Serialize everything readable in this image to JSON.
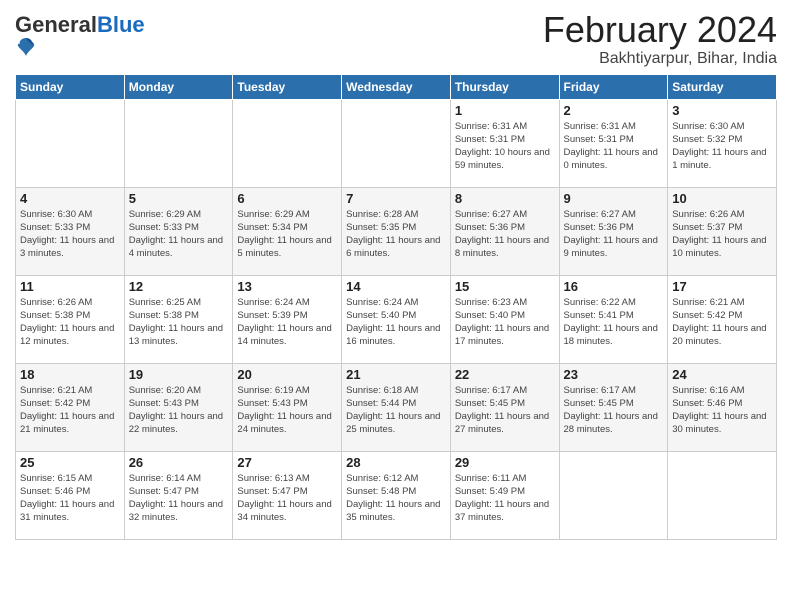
{
  "logo": {
    "general": "General",
    "blue": "Blue"
  },
  "title": "February 2024",
  "subtitle": "Bakhtiyarpur, Bihar, India",
  "weekdays": [
    "Sunday",
    "Monday",
    "Tuesday",
    "Wednesday",
    "Thursday",
    "Friday",
    "Saturday"
  ],
  "weeks": [
    [
      {
        "day": "",
        "info": ""
      },
      {
        "day": "",
        "info": ""
      },
      {
        "day": "",
        "info": ""
      },
      {
        "day": "",
        "info": ""
      },
      {
        "day": "1",
        "info": "Sunrise: 6:31 AM\nSunset: 5:31 PM\nDaylight: 10 hours and 59 minutes."
      },
      {
        "day": "2",
        "info": "Sunrise: 6:31 AM\nSunset: 5:31 PM\nDaylight: 11 hours and 0 minutes."
      },
      {
        "day": "3",
        "info": "Sunrise: 6:30 AM\nSunset: 5:32 PM\nDaylight: 11 hours and 1 minute."
      }
    ],
    [
      {
        "day": "4",
        "info": "Sunrise: 6:30 AM\nSunset: 5:33 PM\nDaylight: 11 hours and 3 minutes."
      },
      {
        "day": "5",
        "info": "Sunrise: 6:29 AM\nSunset: 5:33 PM\nDaylight: 11 hours and 4 minutes."
      },
      {
        "day": "6",
        "info": "Sunrise: 6:29 AM\nSunset: 5:34 PM\nDaylight: 11 hours and 5 minutes."
      },
      {
        "day": "7",
        "info": "Sunrise: 6:28 AM\nSunset: 5:35 PM\nDaylight: 11 hours and 6 minutes."
      },
      {
        "day": "8",
        "info": "Sunrise: 6:27 AM\nSunset: 5:36 PM\nDaylight: 11 hours and 8 minutes."
      },
      {
        "day": "9",
        "info": "Sunrise: 6:27 AM\nSunset: 5:36 PM\nDaylight: 11 hours and 9 minutes."
      },
      {
        "day": "10",
        "info": "Sunrise: 6:26 AM\nSunset: 5:37 PM\nDaylight: 11 hours and 10 minutes."
      }
    ],
    [
      {
        "day": "11",
        "info": "Sunrise: 6:26 AM\nSunset: 5:38 PM\nDaylight: 11 hours and 12 minutes."
      },
      {
        "day": "12",
        "info": "Sunrise: 6:25 AM\nSunset: 5:38 PM\nDaylight: 11 hours and 13 minutes."
      },
      {
        "day": "13",
        "info": "Sunrise: 6:24 AM\nSunset: 5:39 PM\nDaylight: 11 hours and 14 minutes."
      },
      {
        "day": "14",
        "info": "Sunrise: 6:24 AM\nSunset: 5:40 PM\nDaylight: 11 hours and 16 minutes."
      },
      {
        "day": "15",
        "info": "Sunrise: 6:23 AM\nSunset: 5:40 PM\nDaylight: 11 hours and 17 minutes."
      },
      {
        "day": "16",
        "info": "Sunrise: 6:22 AM\nSunset: 5:41 PM\nDaylight: 11 hours and 18 minutes."
      },
      {
        "day": "17",
        "info": "Sunrise: 6:21 AM\nSunset: 5:42 PM\nDaylight: 11 hours and 20 minutes."
      }
    ],
    [
      {
        "day": "18",
        "info": "Sunrise: 6:21 AM\nSunset: 5:42 PM\nDaylight: 11 hours and 21 minutes."
      },
      {
        "day": "19",
        "info": "Sunrise: 6:20 AM\nSunset: 5:43 PM\nDaylight: 11 hours and 22 minutes."
      },
      {
        "day": "20",
        "info": "Sunrise: 6:19 AM\nSunset: 5:43 PM\nDaylight: 11 hours and 24 minutes."
      },
      {
        "day": "21",
        "info": "Sunrise: 6:18 AM\nSunset: 5:44 PM\nDaylight: 11 hours and 25 minutes."
      },
      {
        "day": "22",
        "info": "Sunrise: 6:17 AM\nSunset: 5:45 PM\nDaylight: 11 hours and 27 minutes."
      },
      {
        "day": "23",
        "info": "Sunrise: 6:17 AM\nSunset: 5:45 PM\nDaylight: 11 hours and 28 minutes."
      },
      {
        "day": "24",
        "info": "Sunrise: 6:16 AM\nSunset: 5:46 PM\nDaylight: 11 hours and 30 minutes."
      }
    ],
    [
      {
        "day": "25",
        "info": "Sunrise: 6:15 AM\nSunset: 5:46 PM\nDaylight: 11 hours and 31 minutes."
      },
      {
        "day": "26",
        "info": "Sunrise: 6:14 AM\nSunset: 5:47 PM\nDaylight: 11 hours and 32 minutes."
      },
      {
        "day": "27",
        "info": "Sunrise: 6:13 AM\nSunset: 5:47 PM\nDaylight: 11 hours and 34 minutes."
      },
      {
        "day": "28",
        "info": "Sunrise: 6:12 AM\nSunset: 5:48 PM\nDaylight: 11 hours and 35 minutes."
      },
      {
        "day": "29",
        "info": "Sunrise: 6:11 AM\nSunset: 5:49 PM\nDaylight: 11 hours and 37 minutes."
      },
      {
        "day": "",
        "info": ""
      },
      {
        "day": "",
        "info": ""
      }
    ]
  ],
  "colors": {
    "header_bg": "#2b6fad",
    "header_text": "#ffffff",
    "accent_blue": "#1a6bbf"
  }
}
